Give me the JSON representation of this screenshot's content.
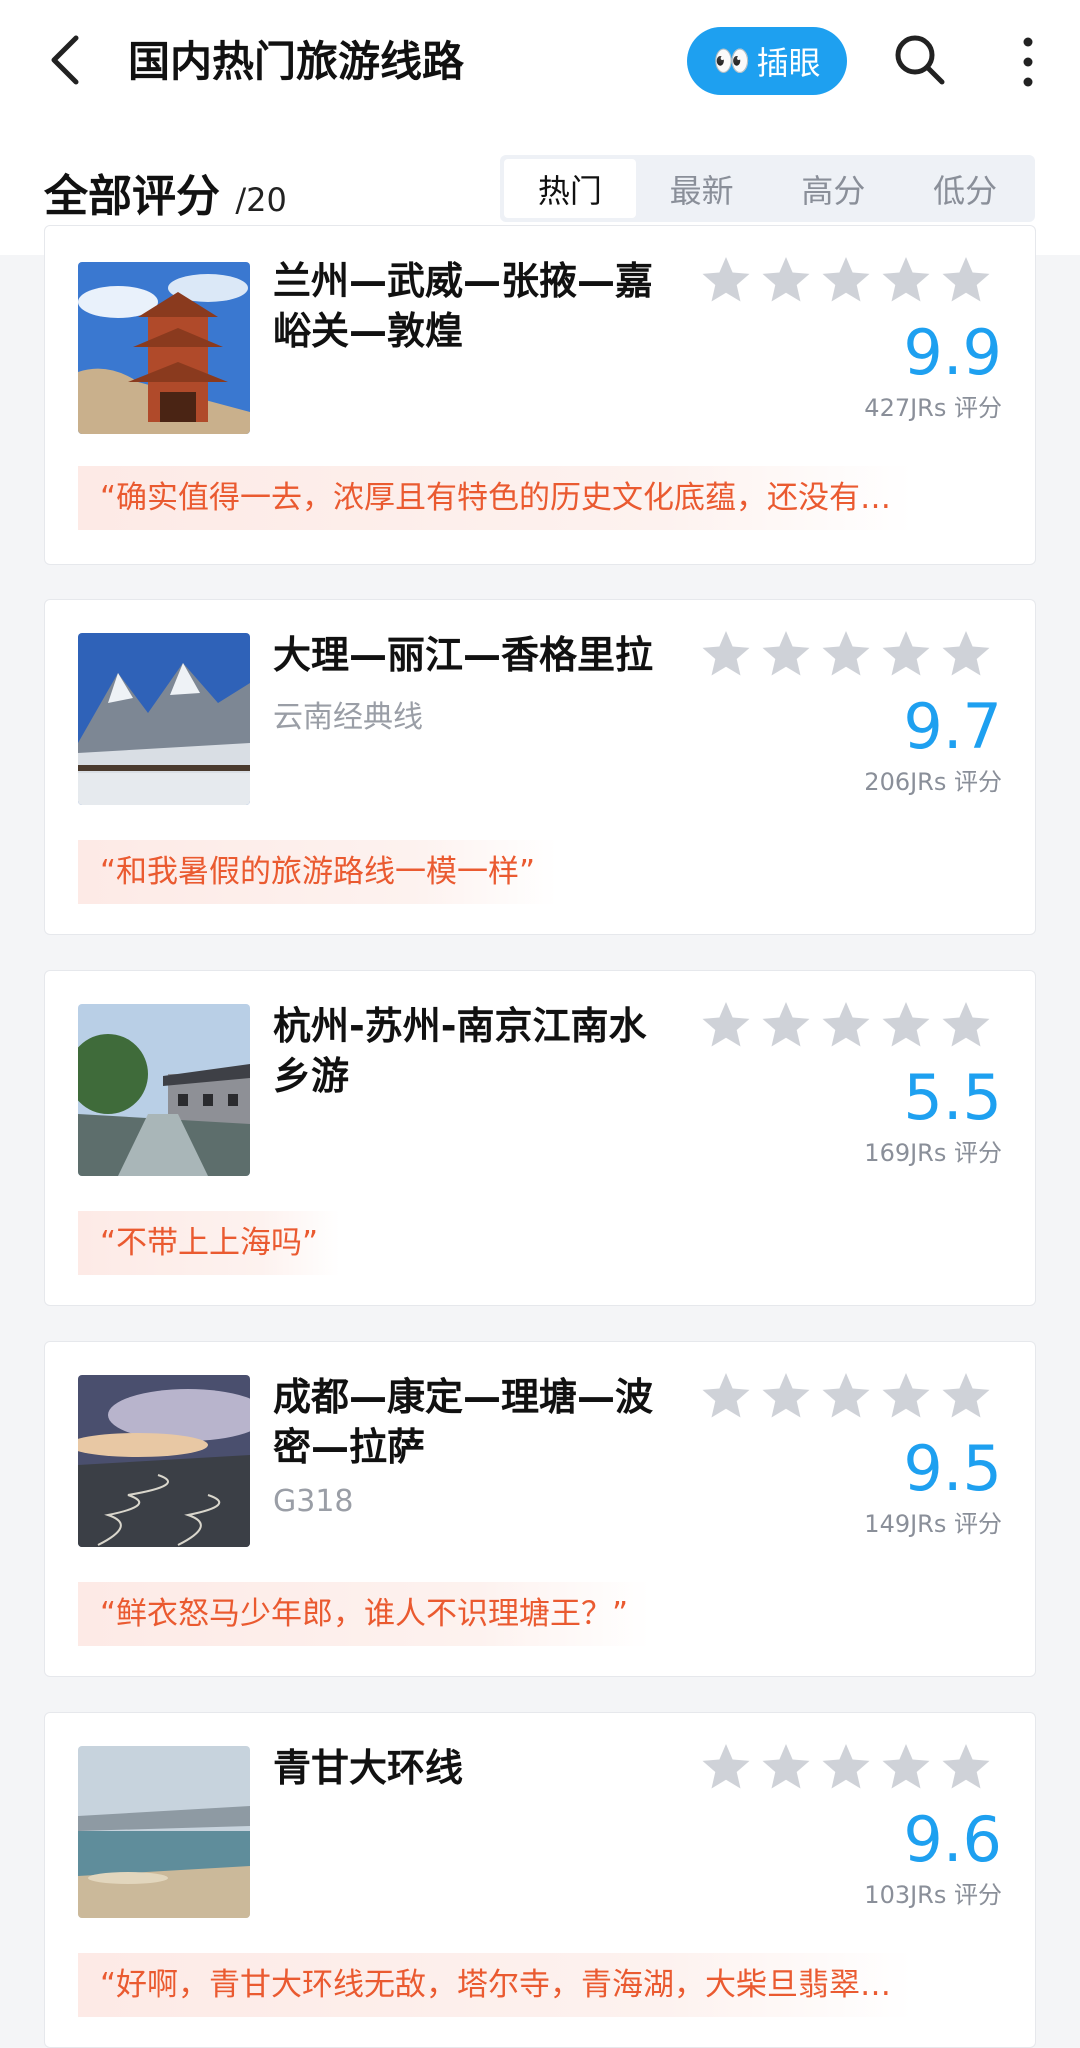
{
  "header": {
    "title": "国内热门旅游线路",
    "peek_button": {
      "emoji": "👀",
      "label": "插眼"
    },
    "icons": [
      "back-icon",
      "search-icon",
      "more-icon"
    ]
  },
  "subheader": {
    "label": "全部评分",
    "count": "/20",
    "tabs": [
      "热门",
      "最新",
      "高分",
      "低分"
    ],
    "active_tab": "热门"
  },
  "routes": [
    {
      "title": "兰州—武威—张掖—嘉峪关—敦煌",
      "subtitle": "",
      "score": "9.9",
      "raters": "427JRs 评分",
      "stars_filled": 0,
      "quote": "“确实值得一去，浓厚且有特色的历史文化底蕴，还没有…"
    },
    {
      "title": "大理—丽江—香格里拉",
      "subtitle": "云南经典线",
      "score": "9.7",
      "raters": "206JRs 评分",
      "stars_filled": 0,
      "quote": "“和我暑假的旅游路线一模一样”"
    },
    {
      "title": "杭州-苏州-南京江南水乡游",
      "subtitle": "",
      "score": "5.5",
      "raters": "169JRs 评分",
      "stars_filled": 0,
      "quote": "“不带上上海吗”"
    },
    {
      "title": "成都—康定—理塘—波密—拉萨",
      "subtitle": "G318",
      "score": "9.5",
      "raters": "149JRs 评分",
      "stars_filled": 0,
      "quote": "“鲜衣怒马少年郎，谁人不识理塘王？”"
    },
    {
      "title": "青甘大环线",
      "subtitle": "",
      "score": "9.6",
      "raters": "103JRs 评分",
      "stars_filled": 0,
      "quote": "“好啊，青甘大环线无敌，塔尔寺，青海湖，大柴旦翡翠…"
    }
  ],
  "colors": {
    "accent": "#1ea0f0",
    "quote_text": "#ea5a30",
    "star_empty": "#cfd2d8"
  }
}
